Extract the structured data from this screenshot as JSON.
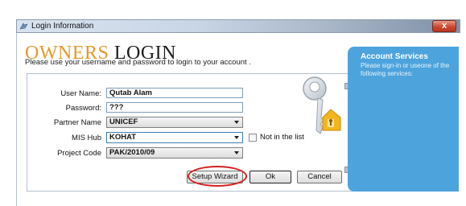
{
  "window": {
    "title": "Login Information",
    "close_glyph": "x"
  },
  "header": {
    "title_word1": "OWNERS",
    "title_word2": "LOGIN",
    "subtitle": "Please use your username and password to login to your account ."
  },
  "form": {
    "username_label": "User Name:",
    "username_value": "Qutab Alam",
    "password_label": "Password:",
    "password_value": "???",
    "partner_label": "Partner Name",
    "partner_value": "UNICEF",
    "mishub_label": "MIS Hub",
    "mishub_value": "KOHAT",
    "not_in_list_label": "Not in the list",
    "project_label": "Project Code",
    "project_value": "PAK/2010/09"
  },
  "buttons": {
    "setup_wizard": "Setup Wizard",
    "ok": "Ok",
    "cancel": "Cancel"
  },
  "account_services": {
    "title": "Account Services",
    "text": "Please sign-in or useone of the following services:"
  },
  "icons": {
    "title_icon": "app-icon",
    "key": "key-icon",
    "house": "house-tag-icon"
  },
  "colors": {
    "accent_orange": "#e39a2d",
    "panel_blue": "#4da3dc",
    "highlight_red": "#d42020"
  }
}
